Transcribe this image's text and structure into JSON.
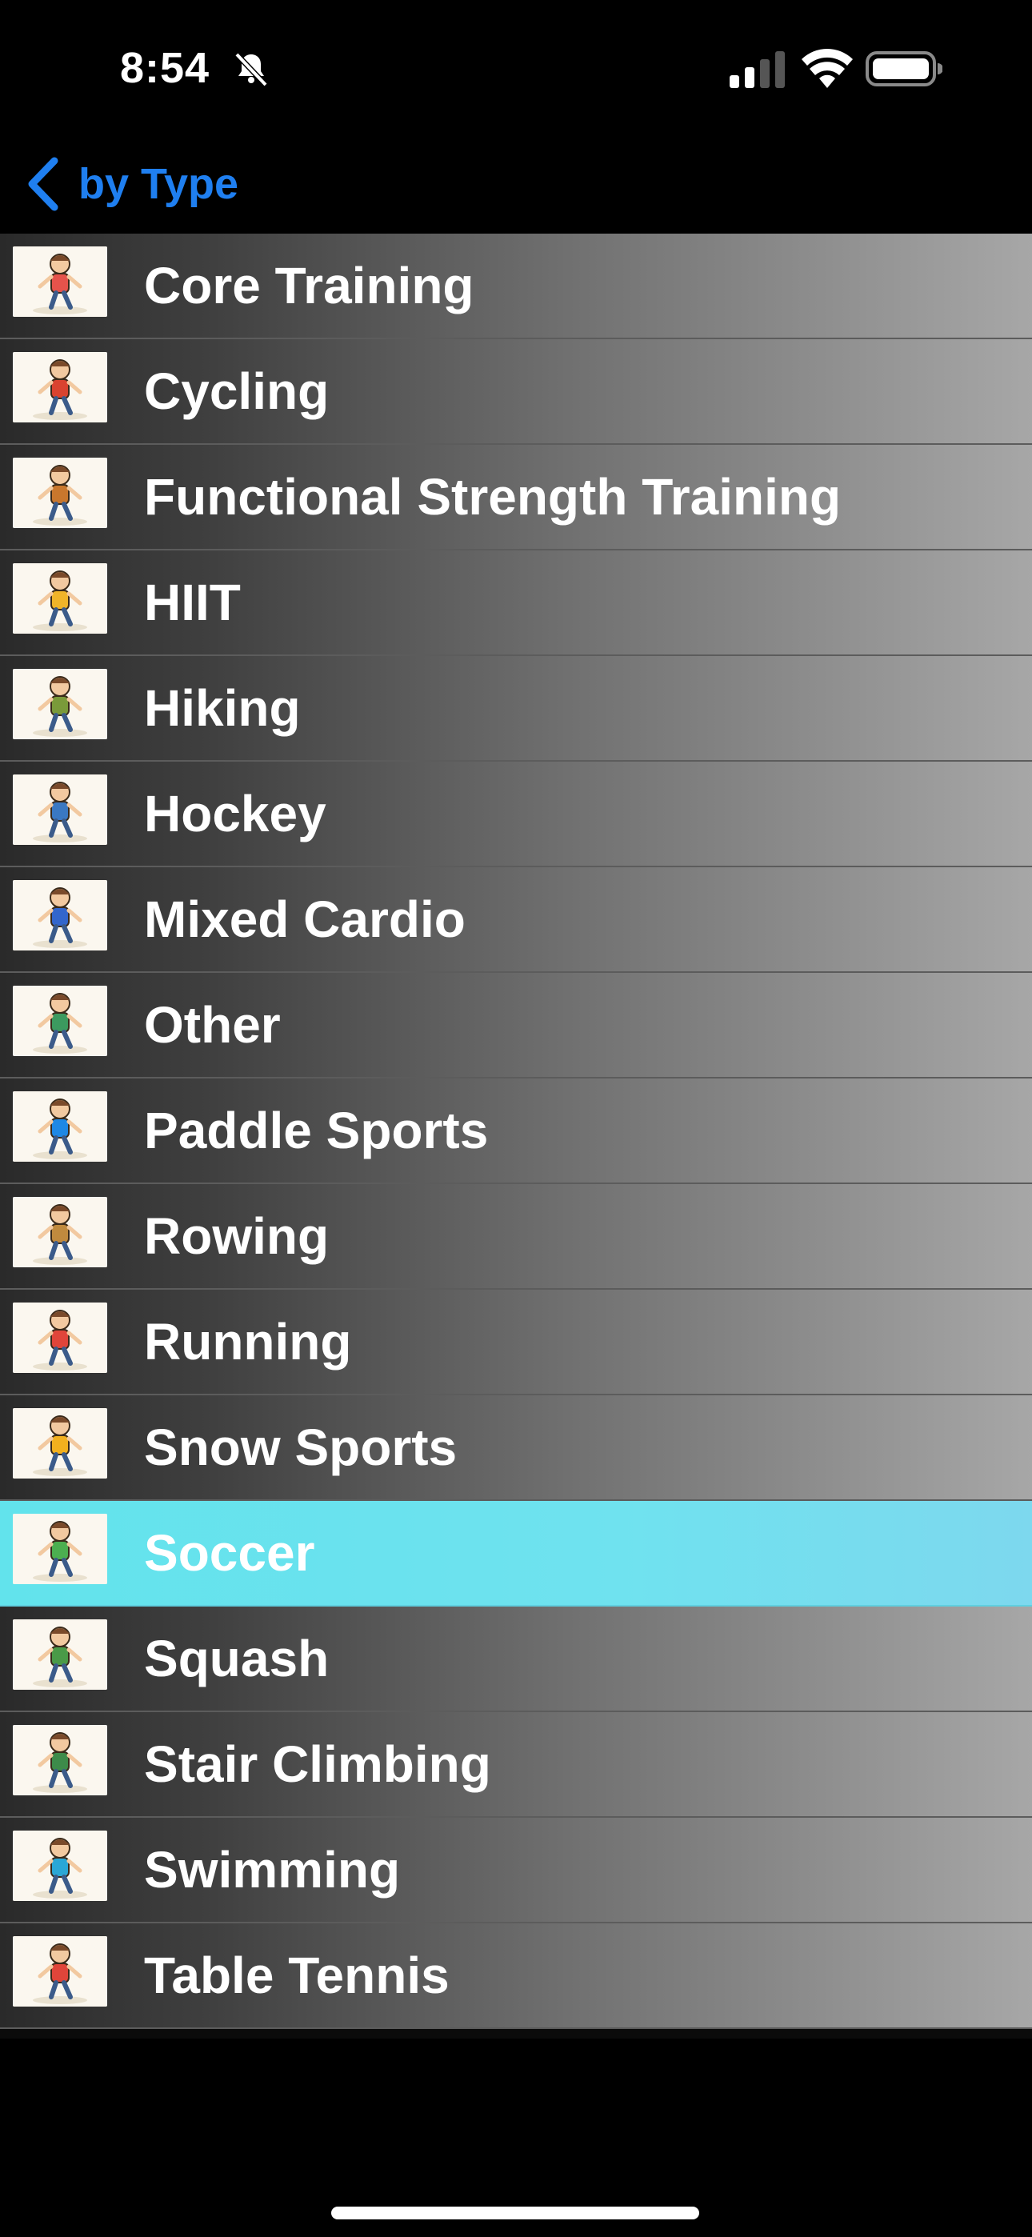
{
  "status_bar": {
    "time": "8:54"
  },
  "nav": {
    "back_label": "by Type"
  },
  "list": {
    "selected_index": 12,
    "items": [
      {
        "label": "Core Training",
        "icon": "core-training-icon",
        "accent": "#e5534b"
      },
      {
        "label": "Cycling",
        "icon": "cycling-icon",
        "accent": "#d9432f"
      },
      {
        "label": "Functional Strength Training",
        "icon": "functional-strength-icon",
        "accent": "#c9772d"
      },
      {
        "label": "HIIT",
        "icon": "hiit-icon",
        "accent": "#f0b429"
      },
      {
        "label": "Hiking",
        "icon": "hiking-icon",
        "accent": "#7a9a3a"
      },
      {
        "label": "Hockey",
        "icon": "hockey-icon",
        "accent": "#3a78c2"
      },
      {
        "label": "Mixed Cardio",
        "icon": "mixed-cardio-icon",
        "accent": "#3366cc"
      },
      {
        "label": "Other",
        "icon": "other-icon",
        "accent": "#3c9a5f"
      },
      {
        "label": "Paddle Sports",
        "icon": "paddle-sports-icon",
        "accent": "#1e88e5"
      },
      {
        "label": "Rowing",
        "icon": "rowing-icon",
        "accent": "#c08a3e"
      },
      {
        "label": "Running",
        "icon": "running-icon",
        "accent": "#e0453a"
      },
      {
        "label": "Snow Sports",
        "icon": "snow-sports-icon",
        "accent": "#f2b01e"
      },
      {
        "label": "Soccer",
        "icon": "soccer-icon",
        "accent": "#4caf50"
      },
      {
        "label": "Squash",
        "icon": "squash-icon",
        "accent": "#4a9a48"
      },
      {
        "label": "Stair Climbing",
        "icon": "stair-climbing-icon",
        "accent": "#3d8b4a"
      },
      {
        "label": "Swimming",
        "icon": "swimming-icon",
        "accent": "#2aa7d6"
      },
      {
        "label": "Table Tennis",
        "icon": "table-tennis-icon",
        "accent": "#e0453a"
      }
    ]
  }
}
